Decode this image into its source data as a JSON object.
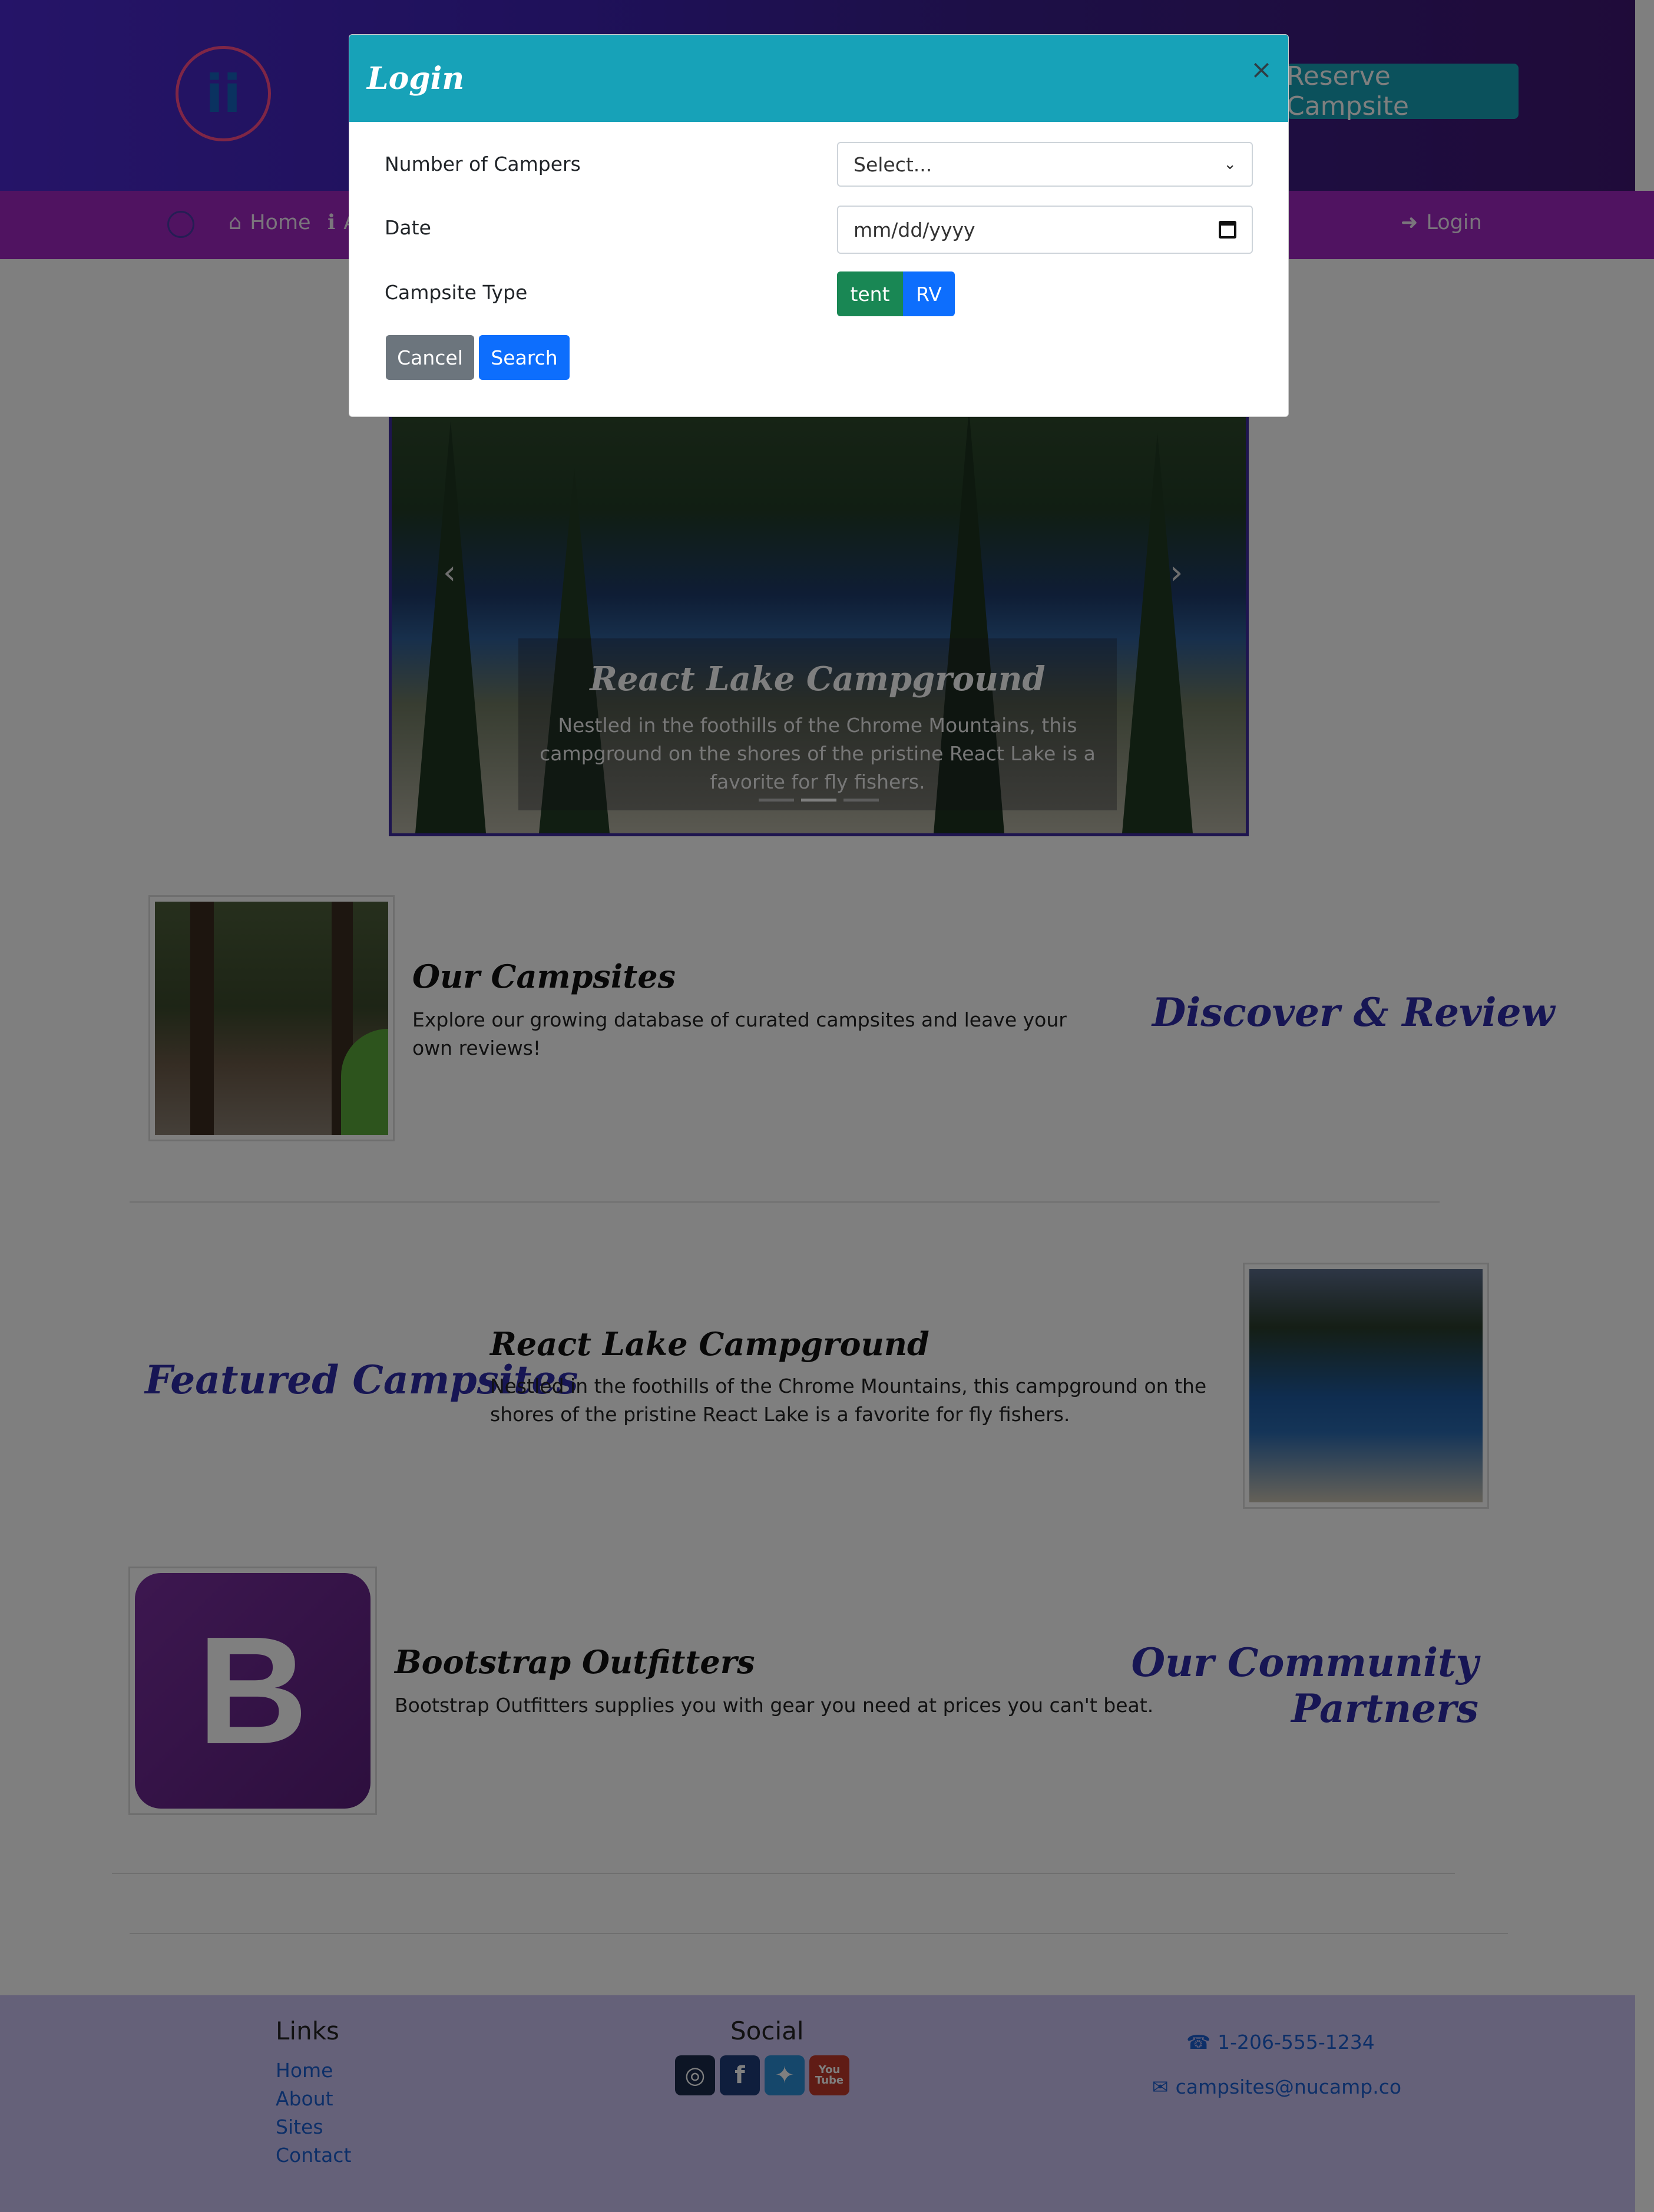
{
  "header": {
    "logo_glyph": "ii",
    "reserve_button": "Reserve Campsite"
  },
  "navbar": {
    "home": "Home",
    "about_partial": "A",
    "login": "Login"
  },
  "carousel": {
    "title": "React Lake Campground",
    "text": "Nestled in the foothills of the Chrome Mountains, this campground on the shores of the pristine React Lake is a favorite for fly fishers.",
    "prev": "‹",
    "next": "›",
    "active_indicator": 2
  },
  "sections": {
    "campsites": {
      "title": "Our Campsites",
      "text": "Explore our growing database of curated campsites and leave your own reviews!",
      "tagline": "Discover & Review"
    },
    "featured": {
      "heading": "Featured Campsites",
      "title": "React Lake Campground",
      "text": "Nestled in the foothills of the Chrome Mountains, this campground on the shores of the pristine React Lake is a favorite for fly fishers."
    },
    "partners": {
      "logo_letter": "B",
      "title": "Bootstrap Outfitters",
      "text": "Bootstrap Outfitters supplies you with gear you need at prices you can't beat.",
      "heading_line1": "Our Community",
      "heading_line2": "Partners"
    }
  },
  "footer": {
    "links_heading": "Links",
    "links": [
      "Home",
      "About",
      "Sites",
      "Contact"
    ],
    "social_heading": "Social",
    "social_icons": [
      "instagram-icon",
      "facebook-icon",
      "twitter-icon",
      "youtube-icon"
    ],
    "youtube_label_1": "You",
    "youtube_label_2": "Tube",
    "phone": "1-206-555-1234",
    "email": "campsites@nucamp.co"
  },
  "modal": {
    "title": "Login",
    "close": "×",
    "campers_label": "Number of Campers",
    "campers_value": "Select...",
    "date_label": "Date",
    "date_placeholder": "mm/dd/yyyy",
    "type_label": "Campsite Type",
    "type_options": [
      "tent",
      "RV"
    ],
    "cancel": "Cancel",
    "search": "Search"
  },
  "colors": {
    "modal_header": "#17a2b8",
    "tent": "#198754",
    "rv": "#0d6efd",
    "cancel": "#6c757d",
    "search": "#0d6efd"
  }
}
